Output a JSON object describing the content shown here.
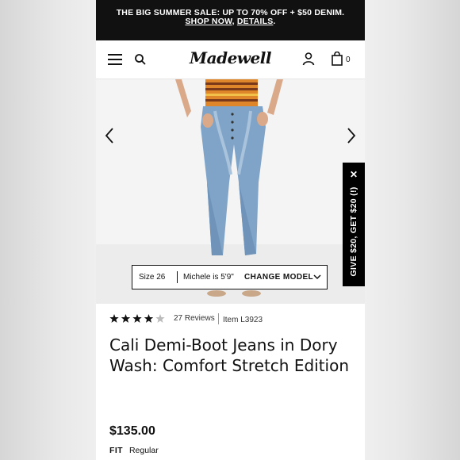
{
  "promo": {
    "line1": "THE BIG SUMMER SALE: UP TO 70% OFF + $50 DENIM.",
    "shop_now": "SHOP NOW",
    "comma": ", ",
    "details": "DETAILS",
    "period": "."
  },
  "header": {
    "logo": "Madewell",
    "bag_count": "0"
  },
  "icons": [
    "hamburger-menu-icon",
    "search-icon",
    "user-icon",
    "bag-icon",
    "chevron-left-icon",
    "chevron-right-icon",
    "close-icon",
    "chevron-down-icon",
    "star-icon"
  ],
  "gallery": {
    "model_size": "Size 26",
    "model_height": "Michele is 5'9\"",
    "change_model": "CHANGE MODEL"
  },
  "referral": {
    "label": "GIVE $20, GET $20 (!)",
    "close": "✕"
  },
  "product": {
    "rating": 4,
    "rating_max": 5,
    "reviews": "27 Reviews",
    "item": "Item L3923",
    "title": "Cali Demi-Boot Jeans in Dory Wash: Comfort Stretch Edition",
    "price": "$135.00",
    "fit_label": "FIT",
    "fit_value": "Regular"
  },
  "colors": {
    "promo_bg": "#111111",
    "accent": "#111111",
    "denim": "#7fa4c8",
    "stripe_orange": "#e0862a"
  }
}
